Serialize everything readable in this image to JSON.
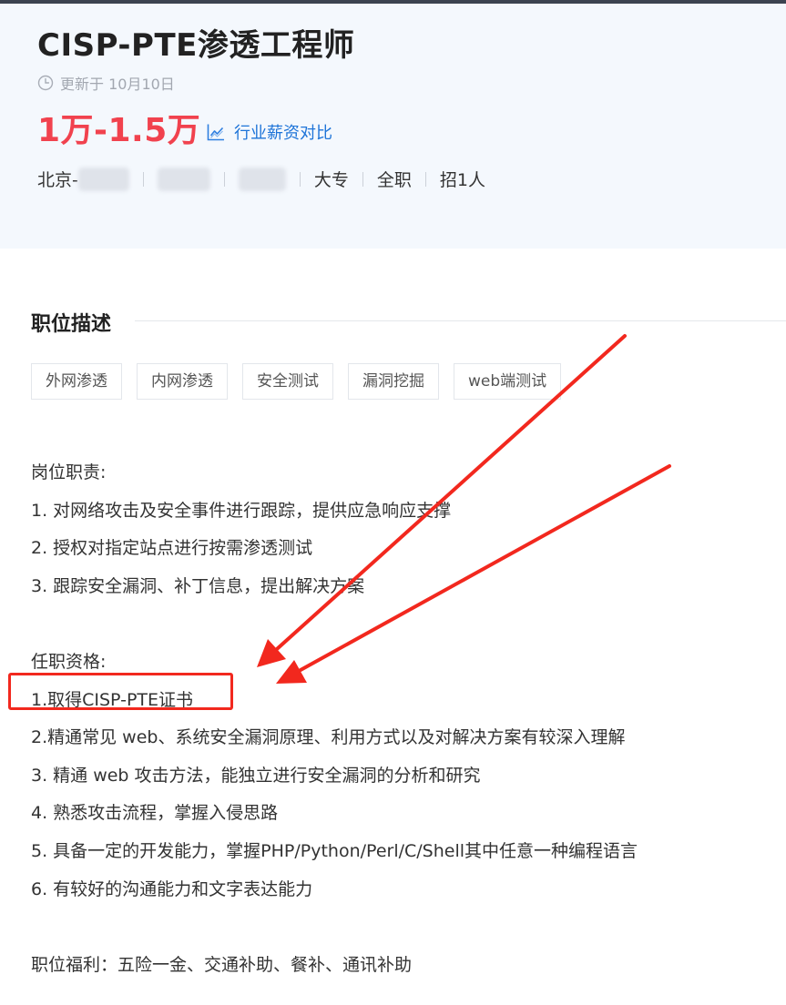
{
  "job": {
    "title": "CISP-PTE渗透工程师",
    "updated": "更新于 10月10日",
    "salary": "1万-1.5万",
    "salary_compare": "行业薪资对比",
    "meta": {
      "location_visible": "北京-",
      "education": "大专",
      "job_type": "全职",
      "headcount": "招1人"
    }
  },
  "description": {
    "section_title": "职位描述",
    "tags": [
      "外网渗透",
      "内网渗透",
      "安全测试",
      "漏洞挖掘",
      "web端测试"
    ],
    "lines": [
      "岗位职责:",
      "1. 对网络攻击及安全事件进行跟踪，提供应急响应支撑",
      "2. 授权对指定站点进行按需渗透测试",
      "3. 跟踪安全漏洞、补丁信息，提出解决方案",
      "",
      "任职资格:",
      "1.取得CISP-PTE证书",
      "2.精通常见 web、系统安全漏洞原理、利用方式以及对解决方案有较深入理解",
      "3. 精通 web 攻击方法，能独立进行安全漏洞的分析和研究",
      "4. 熟悉攻击流程，掌握入侵思路",
      "5. 具备一定的开发能力，掌握PHP/Python/Perl/C/Shell其中任意一种编程语言",
      "6. 有较好的沟通能力和文字表达能力",
      "",
      "职位福利：五险一金、交通补助、餐补、通讯补助"
    ]
  },
  "annotation": {
    "color": "#f2281e"
  },
  "colors": {
    "salary": "#f1424e",
    "link": "#1e74d8",
    "header_bg": "#f4f8fd"
  }
}
